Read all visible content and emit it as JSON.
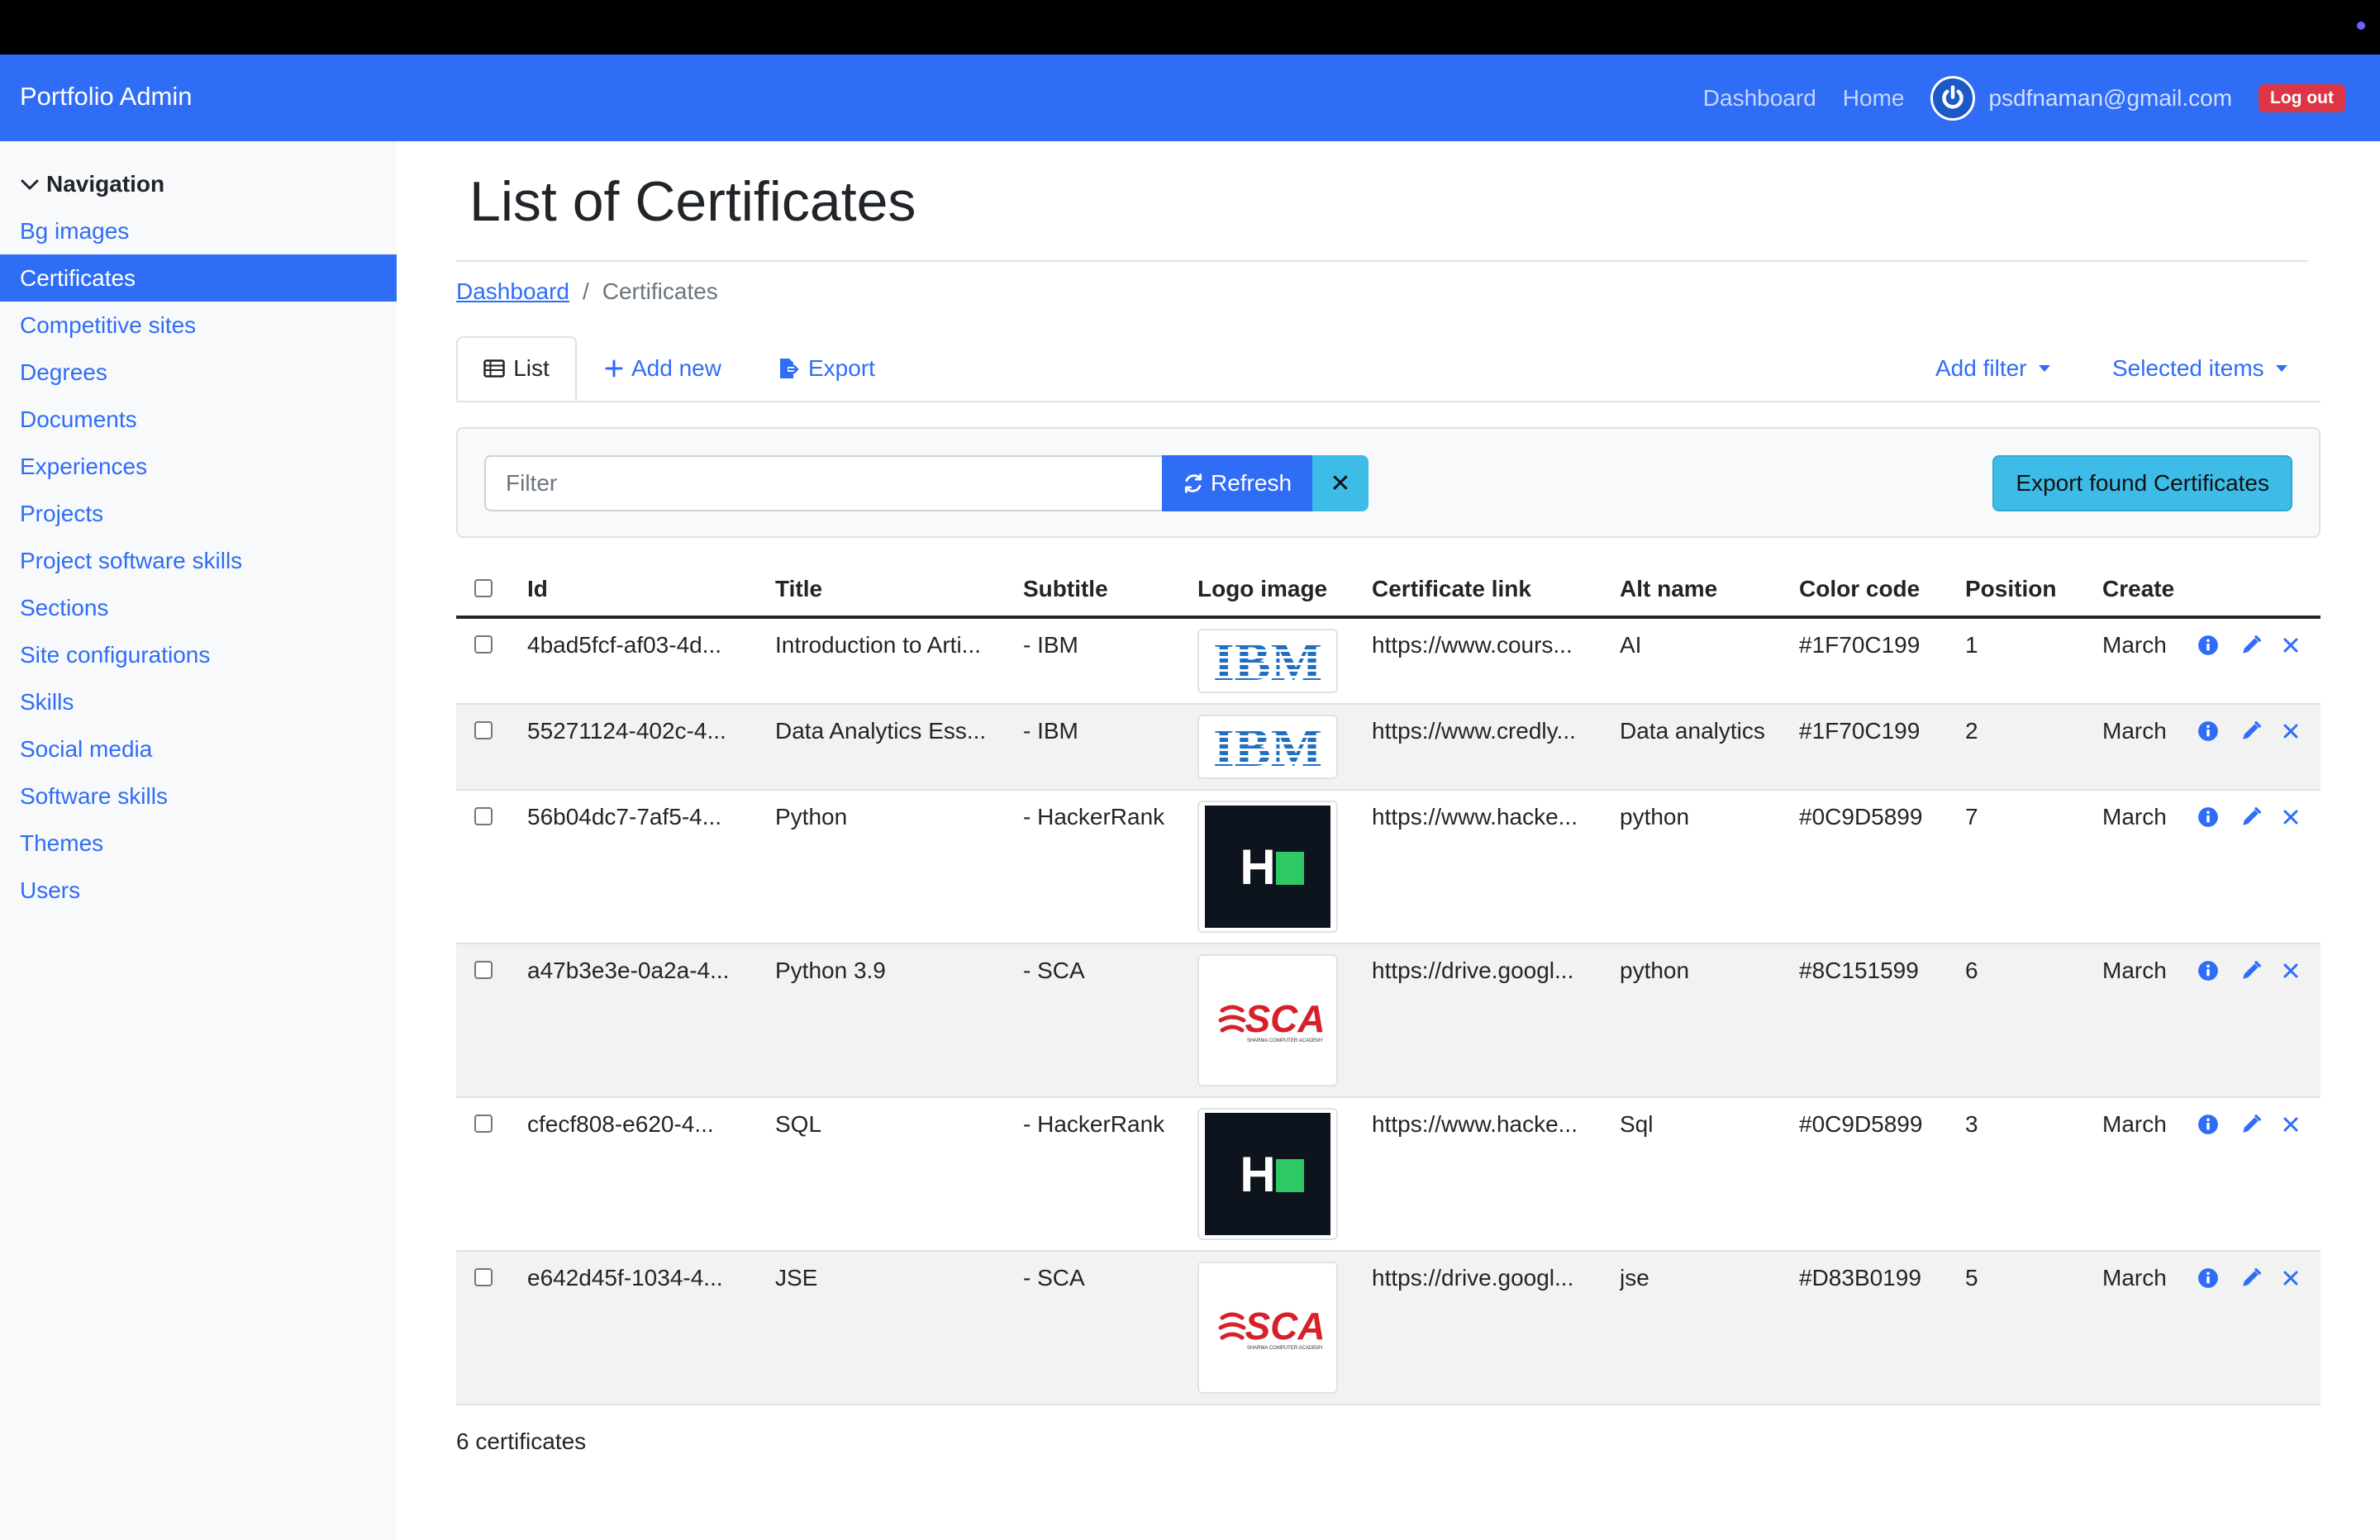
{
  "navbar": {
    "brand_main": "Portfolio",
    "brand_sub": "Admin",
    "links": [
      "Dashboard",
      "Home"
    ],
    "user_email": "psdfnaman@gmail.com",
    "logout_label": "Log out"
  },
  "sidebar": {
    "heading": "Navigation",
    "items": [
      {
        "label": "Bg images",
        "active": false
      },
      {
        "label": "Certificates",
        "active": true
      },
      {
        "label": "Competitive sites",
        "active": false
      },
      {
        "label": "Degrees",
        "active": false
      },
      {
        "label": "Documents",
        "active": false
      },
      {
        "label": "Experiences",
        "active": false
      },
      {
        "label": "Projects",
        "active": false
      },
      {
        "label": "Project software skills",
        "active": false
      },
      {
        "label": "Sections",
        "active": false
      },
      {
        "label": "Site configurations",
        "active": false
      },
      {
        "label": "Skills",
        "active": false
      },
      {
        "label": "Social media",
        "active": false
      },
      {
        "label": "Software skills",
        "active": false
      },
      {
        "label": "Themes",
        "active": false
      },
      {
        "label": "Users",
        "active": false
      }
    ]
  },
  "page": {
    "title": "List of Certificates",
    "breadcrumb": {
      "parent": "Dashboard",
      "separator": "/",
      "current": "Certificates"
    }
  },
  "tabs": {
    "list": "List",
    "add_new": "Add new",
    "export": "Export",
    "add_filter": "Add filter",
    "selected_items": "Selected items"
  },
  "filter": {
    "placeholder": "Filter",
    "value": "",
    "refresh_label": "Refresh",
    "clear_label": "✕",
    "export_found_label": "Export found Certificates"
  },
  "table": {
    "columns": [
      "Id",
      "Title",
      "Subtitle",
      "Logo image",
      "Certificate link",
      "Alt name",
      "Color code",
      "Position",
      "Create"
    ],
    "rows": [
      {
        "id": "4bad5fcf-af03-4d...",
        "title": "Introduction to Arti...",
        "subtitle": "- IBM",
        "logo": "ibm",
        "link": "https://www.cours...",
        "alt": "AI",
        "color": "#1F70C199",
        "position": "1",
        "created": "March"
      },
      {
        "id": "55271124-402c-4...",
        "title": "Data Analytics Ess...",
        "subtitle": "- IBM",
        "logo": "ibm",
        "link": "https://www.credly...",
        "alt": "Data analytics",
        "color": "#1F70C199",
        "position": "2",
        "created": "March"
      },
      {
        "id": "56b04dc7-7af5-4...",
        "title": "Python",
        "subtitle": "- HackerRank",
        "logo": "hackerrank",
        "link": "https://www.hacke...",
        "alt": "python",
        "color": "#0C9D5899",
        "position": "7",
        "created": "March"
      },
      {
        "id": "a47b3e3e-0a2a-4...",
        "title": "Python 3.9",
        "subtitle": "- SCA",
        "logo": "sca",
        "link": "https://drive.googl...",
        "alt": "python",
        "color": "#8C151599",
        "position": "6",
        "created": "March"
      },
      {
        "id": "cfecf808-e620-4...",
        "title": "SQL",
        "subtitle": "- HackerRank",
        "logo": "hackerrank",
        "link": "https://www.hacke...",
        "alt": "Sql",
        "color": "#0C9D5899",
        "position": "3",
        "created": "March"
      },
      {
        "id": "e642d45f-1034-4...",
        "title": "JSE",
        "subtitle": "- SCA",
        "logo": "sca",
        "link": "https://drive.googl...",
        "alt": "jse",
        "color": "#D83B0199",
        "position": "5",
        "created": "March"
      }
    ],
    "count_label": "6 certificates"
  },
  "logos": {
    "ibm_text": "IBM",
    "hackerrank_text": "H",
    "sca_text": "SCA",
    "sca_tagline": "SHARMA COMPUTER ACADEMY"
  },
  "colors": {
    "primary": "#2f6df6",
    "info": "#3dbce8",
    "danger": "#dc3545",
    "hackerrank_bg": "#0e141e",
    "hackerrank_green": "#2ec866",
    "ibm_blue": "#1f70c1",
    "sca_red": "#d6202a"
  }
}
